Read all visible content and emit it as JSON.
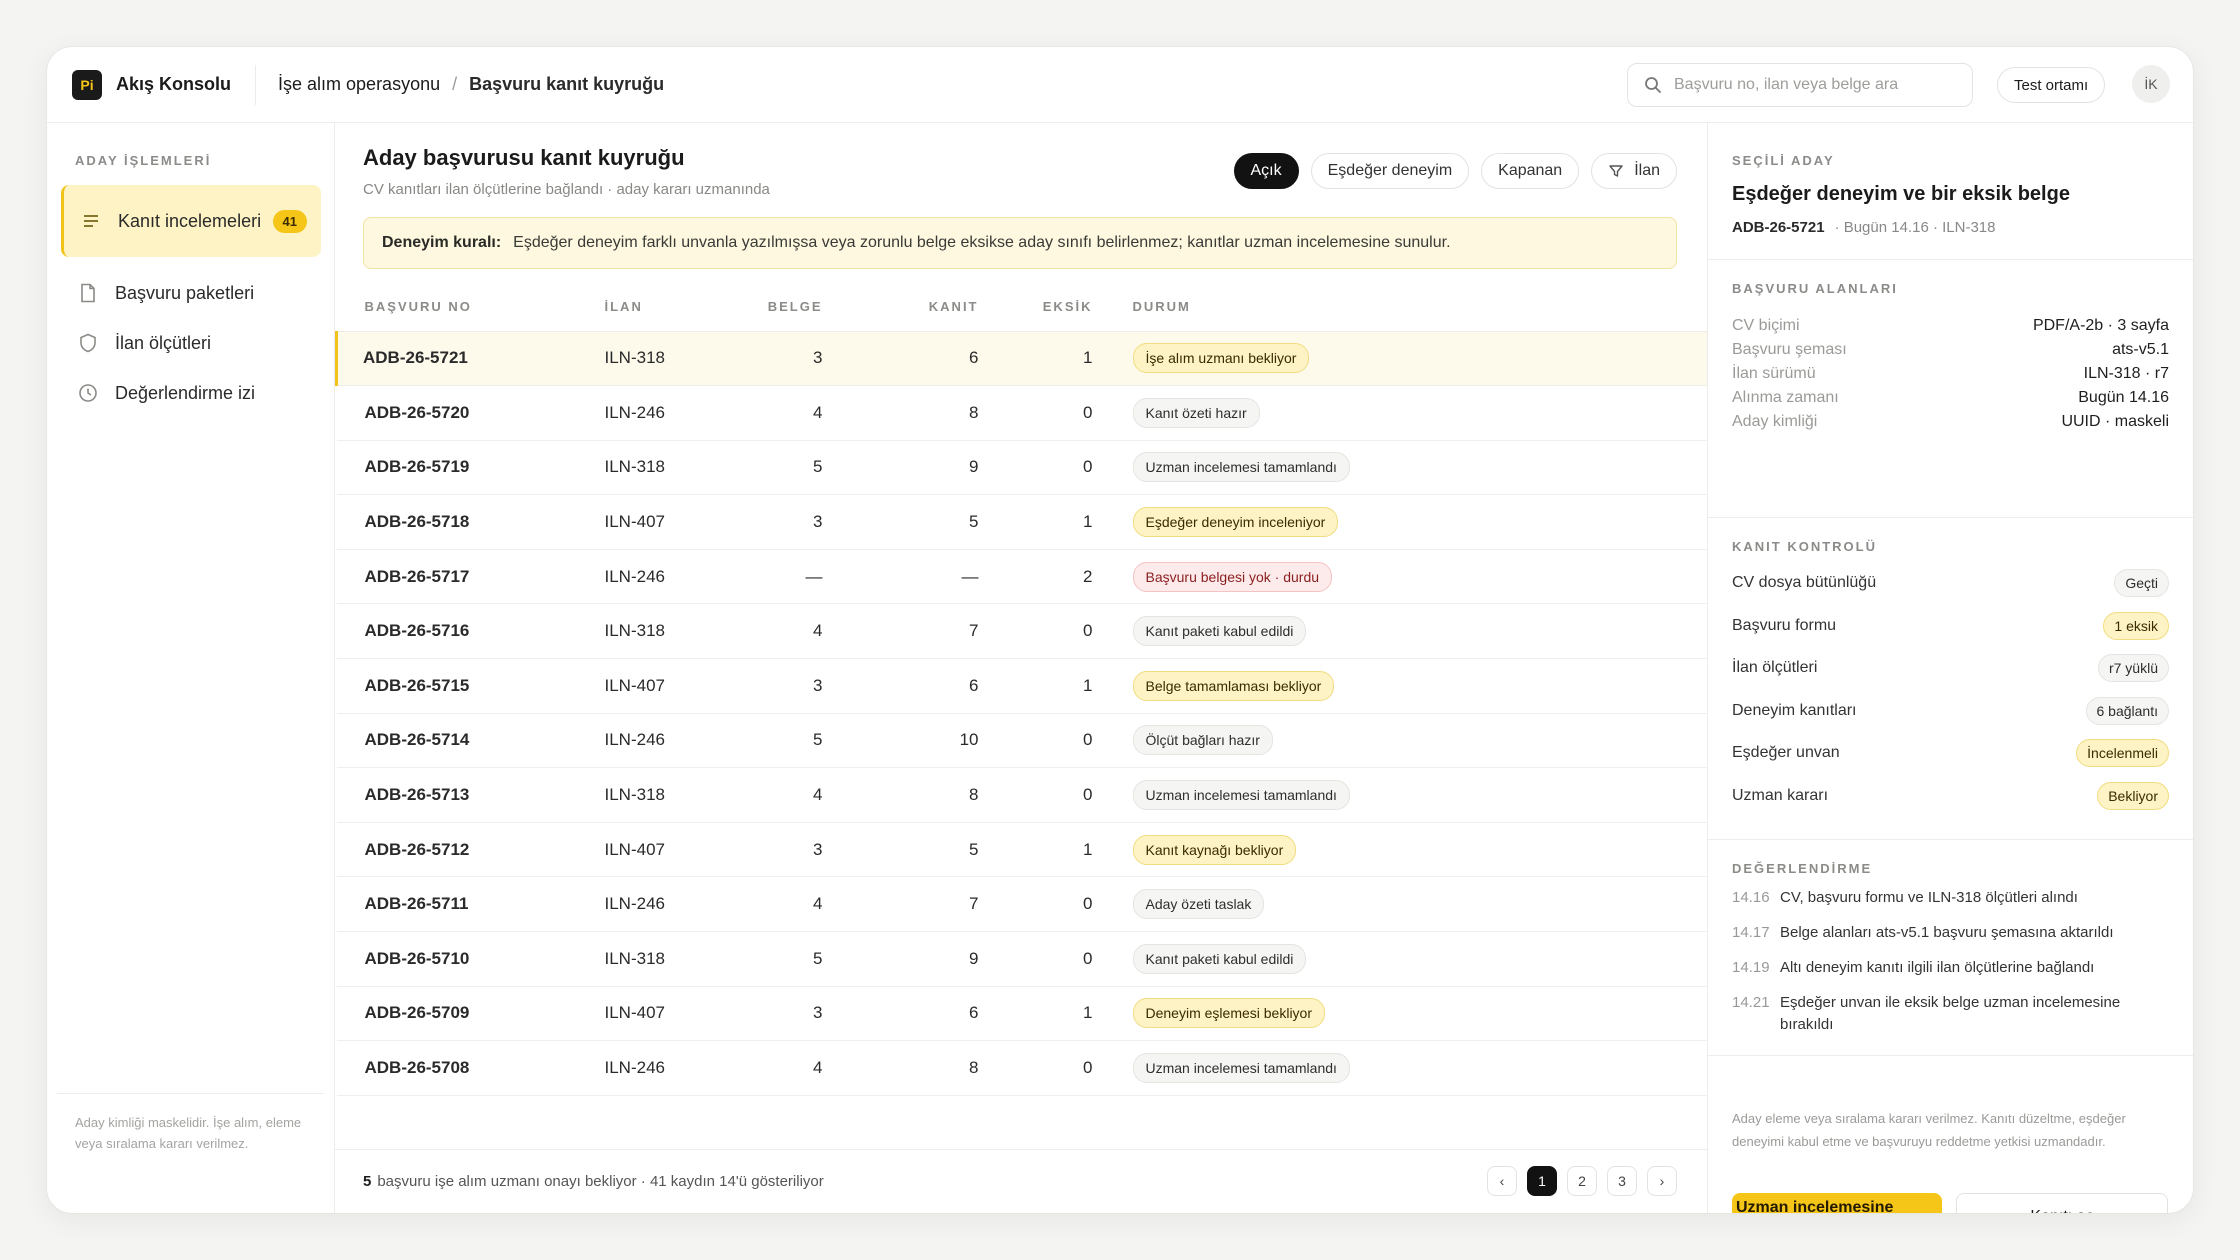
{
  "app": {
    "logo_text": "Pi",
    "name": "Akış Konsolu"
  },
  "breadcrumb": {
    "parent": "İşe alım operasyonu",
    "sep": "/",
    "current": "Başvuru kanıt kuyruğu"
  },
  "search": {
    "placeholder": "Başvuru no, ilan veya belge ara"
  },
  "env_label": "Test ortamı",
  "avatar": "İK",
  "sidebar": {
    "section": "ADAY İŞLEMLERİ",
    "items": [
      {
        "label": "Kanıt incelemeleri",
        "badge": "41"
      },
      {
        "label": "Başvuru paketleri"
      },
      {
        "label": "İlan ölçütleri"
      },
      {
        "label": "Değerlendirme izi"
      }
    ],
    "footnote": "Aday kimliği maskelidir. İşe alım, eleme veya sıralama kararı verilmez."
  },
  "main": {
    "title": "Aday başvurusu kanıt kuyruğu",
    "subtitle": "CV kanıtları ilan ölçütlerine bağlandı · aday kararı uzmanında",
    "filters": [
      "Açık",
      "Eşdeğer deneyim",
      "Kapanan",
      "İlan"
    ],
    "rule_label": "Deneyim kuralı:",
    "rule_text": "Eşdeğer deneyim farklı unvanla yazılmışsa veya zorunlu belge eksikse aday sınıfı belirlenmez; kanıtlar uzman incelemesine sunulur.",
    "columns": [
      "BAŞVURU NO",
      "İLAN",
      "BELGE",
      "KANIT",
      "EKSİK",
      "DURUM"
    ],
    "rows": [
      {
        "no": "ADB-26-5721",
        "ilan": "ILN-318",
        "belge": "3",
        "kanit": "6",
        "eksik": "1",
        "durum": "İşe alım uzmanı bekliyor",
        "tone": "warn"
      },
      {
        "no": "ADB-26-5720",
        "ilan": "ILN-246",
        "belge": "4",
        "kanit": "8",
        "eksik": "0",
        "durum": "Kanıt özeti hazır",
        "tone": "neutral"
      },
      {
        "no": "ADB-26-5719",
        "ilan": "ILN-318",
        "belge": "5",
        "kanit": "9",
        "eksik": "0",
        "durum": "Uzman incelemesi tamamlandı",
        "tone": "neutral"
      },
      {
        "no": "ADB-26-5718",
        "ilan": "ILN-407",
        "belge": "3",
        "kanit": "5",
        "eksik": "1",
        "durum": "Eşdeğer deneyim inceleniyor",
        "tone": "warn"
      },
      {
        "no": "ADB-26-5717",
        "ilan": "ILN-246",
        "belge": "—",
        "kanit": "—",
        "eksik": "2",
        "durum": "Başvuru belgesi yok · durdu",
        "tone": "err"
      },
      {
        "no": "ADB-26-5716",
        "ilan": "ILN-318",
        "belge": "4",
        "kanit": "7",
        "eksik": "0",
        "durum": "Kanıt paketi kabul edildi",
        "tone": "neutral"
      },
      {
        "no": "ADB-26-5715",
        "ilan": "ILN-407",
        "belge": "3",
        "kanit": "6",
        "eksik": "1",
        "durum": "Belge tamamlaması bekliyor",
        "tone": "warn"
      },
      {
        "no": "ADB-26-5714",
        "ilan": "ILN-246",
        "belge": "5",
        "kanit": "10",
        "eksik": "0",
        "durum": "Ölçüt bağları hazır",
        "tone": "neutral"
      },
      {
        "no": "ADB-26-5713",
        "ilan": "ILN-318",
        "belge": "4",
        "kanit": "8",
        "eksik": "0",
        "durum": "Uzman incelemesi tamamlandı",
        "tone": "neutral"
      },
      {
        "no": "ADB-26-5712",
        "ilan": "ILN-407",
        "belge": "3",
        "kanit": "5",
        "eksik": "1",
        "durum": "Kanıt kaynağı bekliyor",
        "tone": "warn"
      },
      {
        "no": "ADB-26-5711",
        "ilan": "ILN-246",
        "belge": "4",
        "kanit": "7",
        "eksik": "0",
        "durum": "Aday özeti taslak",
        "tone": "neutral"
      },
      {
        "no": "ADB-26-5710",
        "ilan": "ILN-318",
        "belge": "5",
        "kanit": "9",
        "eksik": "0",
        "durum": "Kanıt paketi kabul edildi",
        "tone": "neutral"
      },
      {
        "no": "ADB-26-5709",
        "ilan": "ILN-407",
        "belge": "3",
        "kanit": "6",
        "eksik": "1",
        "durum": "Deneyim eşlemesi bekliyor",
        "tone": "warn"
      },
      {
        "no": "ADB-26-5708",
        "ilan": "ILN-246",
        "belge": "4",
        "kanit": "8",
        "eksik": "0",
        "durum": "Uzman incelemesi tamamlandı",
        "tone": "neutral"
      }
    ],
    "footer_count": "5",
    "footer_text": "başvuru işe alım uzmanı onayı bekliyor · 41 kaydın 14'ü gösteriliyor",
    "pages": [
      "‹",
      "1",
      "2",
      "3",
      "›"
    ]
  },
  "panel": {
    "title": "SEÇİLİ ADAY",
    "name": "Eşdeğer deneyim ve bir eksik belge",
    "id": "ADB-26-5721",
    "meta": "· Bugün 14.16 · ILN-318",
    "fields_title": "BAŞVURU ALANLARI",
    "fields": [
      {
        "k": "CV biçimi",
        "v": "PDF/A-2b · 3 sayfa"
      },
      {
        "k": "Başvuru şeması",
        "v": "ats-v5.1"
      },
      {
        "k": "İlan sürümü",
        "v": "ILN-318 · r7"
      },
      {
        "k": "Alınma zamanı",
        "v": "Bugün 14.16"
      },
      {
        "k": "Aday kimliği",
        "v": "UUID · maskeli"
      }
    ],
    "checks_title": "KANIT KONTROLÜ",
    "checks": [
      {
        "k": "CV dosya bütünlüğü",
        "v": "Geçti",
        "tone": "neutral"
      },
      {
        "k": "Başvuru formu",
        "v": "1 eksik",
        "tone": "warn"
      },
      {
        "k": "İlan ölçütleri",
        "v": "r7 yüklü",
        "tone": "neutral"
      },
      {
        "k": "Deneyim kanıtları",
        "v": "6 bağlantı",
        "tone": "neutral"
      },
      {
        "k": "Eşdeğer unvan",
        "v": "İncelenmeli",
        "tone": "warn"
      },
      {
        "k": "Uzman kararı",
        "v": "Bekliyor",
        "tone": "warn"
      }
    ],
    "log_title": "DEĞERLENDİRME",
    "log": [
      {
        "t": "14.16",
        "text": "CV, başvuru formu ve ILN-318 ölçütleri alındı"
      },
      {
        "t": "14.17",
        "text": "Belge alanları ats-v5.1 başvuru şemasına aktarıldı"
      },
      {
        "t": "14.19",
        "text": "Altı deneyim kanıtı ilgili ilan ölçütlerine bağlandı"
      },
      {
        "t": "14.21",
        "text": "Eşdeğer unvan ile eksik belge uzman incelemesine bırakıldı"
      }
    ],
    "note": "Aday eleme veya sıralama kararı verilmez. Kanıtı düzeltme, eşdeğer deneyimi kabul etme ve başvuruyu reddetme yetkisi uzmandadır.",
    "primary_btn": "Uzman incelemesine gönder",
    "secondary_btn": "Kanıtı aç"
  },
  "colors": {
    "accent": "#f5c518",
    "warn_bg": "#fdf3c4",
    "err_bg": "#fdeaea",
    "dark": "#121212"
  }
}
